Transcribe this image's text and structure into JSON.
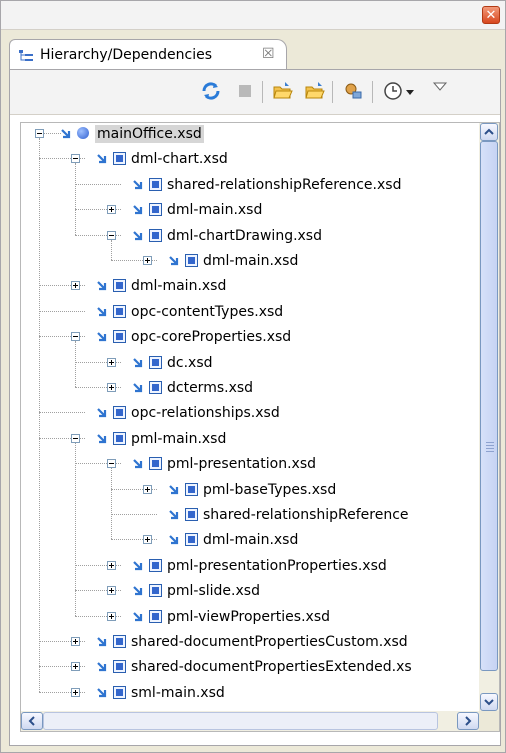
{
  "window": {
    "close_glyph": "✕"
  },
  "tab": {
    "label": "Hierarchy/Dependencies",
    "close_glyph": "☒",
    "icon": "hierarchy-icon"
  },
  "toolbar": {
    "icons": [
      "refresh-icon",
      "stop-icon",
      "open-folder-icon",
      "open-folder-alt-icon",
      "configure-icon",
      "history-icon",
      "view-menu-icon"
    ]
  },
  "tree": {
    "items": [
      {
        "label": "mainOffice.xsd",
        "level": 0,
        "expander": "minus",
        "selected": true,
        "icon": "root-schema"
      },
      {
        "label": "dml-chart.xsd",
        "level": 1,
        "expander": "minus"
      },
      {
        "label": "shared-relationshipReference.xsd",
        "level": 2,
        "expander": "none"
      },
      {
        "label": "dml-main.xsd",
        "level": 2,
        "expander": "plus"
      },
      {
        "label": "dml-chartDrawing.xsd",
        "level": 2,
        "expander": "minus"
      },
      {
        "label": "dml-main.xsd",
        "level": 3,
        "expander": "plus"
      },
      {
        "label": "dml-main.xsd",
        "level": 1,
        "expander": "plus"
      },
      {
        "label": "opc-contentTypes.xsd",
        "level": 1,
        "expander": "none"
      },
      {
        "label": "opc-coreProperties.xsd",
        "level": 1,
        "expander": "minus"
      },
      {
        "label": "dc.xsd",
        "level": 2,
        "expander": "plus"
      },
      {
        "label": "dcterms.xsd",
        "level": 2,
        "expander": "plus"
      },
      {
        "label": "opc-relationships.xsd",
        "level": 1,
        "expander": "none"
      },
      {
        "label": "pml-main.xsd",
        "level": 1,
        "expander": "minus"
      },
      {
        "label": "pml-presentation.xsd",
        "level": 2,
        "expander": "minus"
      },
      {
        "label": "pml-baseTypes.xsd",
        "level": 3,
        "expander": "plus"
      },
      {
        "label": "shared-relationshipReference",
        "level": 3,
        "expander": "none"
      },
      {
        "label": "dml-main.xsd",
        "level": 3,
        "expander": "plus"
      },
      {
        "label": "pml-presentationProperties.xsd",
        "level": 2,
        "expander": "plus"
      },
      {
        "label": "pml-slide.xsd",
        "level": 2,
        "expander": "plus"
      },
      {
        "label": "pml-viewProperties.xsd",
        "level": 2,
        "expander": "plus"
      },
      {
        "label": "shared-documentPropertiesCustom.xsd",
        "level": 1,
        "expander": "plus"
      },
      {
        "label": "shared-documentPropertiesExtended.xs",
        "level": 1,
        "expander": "plus"
      },
      {
        "label": "sml-main.xsd",
        "level": 1,
        "expander": "plus"
      }
    ]
  },
  "scrollbar": {
    "up_glyph": "▲",
    "down_glyph": "▼",
    "left_glyph": "◀",
    "right_glyph": "▶"
  }
}
